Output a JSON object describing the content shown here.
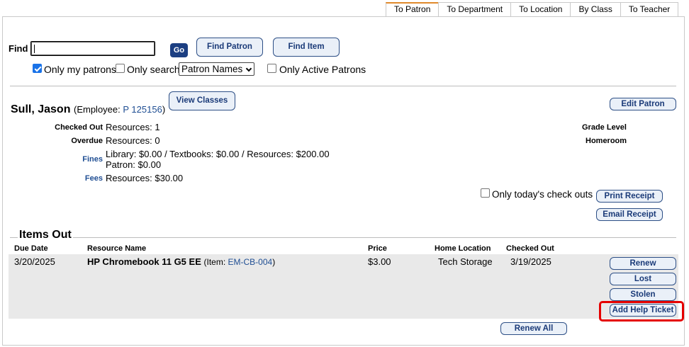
{
  "tabs": [
    {
      "label": "To Patron",
      "active": true
    },
    {
      "label": "To Department",
      "active": false
    },
    {
      "label": "To Location",
      "active": false
    },
    {
      "label": "By Class",
      "active": false
    },
    {
      "label": "To Teacher",
      "active": false
    }
  ],
  "search": {
    "find_label": "Find",
    "find_value": "",
    "go_label": "Go",
    "find_patron_label": "Find Patron",
    "find_item_label": "Find Item",
    "only_my_patrons_label": "Only my patrons",
    "only_my_patrons_checked": true,
    "only_search_label": "Only search",
    "only_search_checked": false,
    "search_scope_selected": "Patron Names",
    "only_active_label": "Only Active Patrons",
    "only_active_checked": false
  },
  "patron": {
    "name": "Sull, Jason",
    "type_prefix": "(Employee: ",
    "id_link": "P 125156",
    "type_suffix": ")",
    "view_classes_label": "View Classes",
    "edit_patron_label": "Edit Patron",
    "checked_out_label": "Checked Out",
    "checked_out_value": "Resources: 1",
    "overdue_label": "Overdue",
    "overdue_value": "Resources: 0",
    "fines_label": "Fines",
    "fines_line1": "Library: $0.00 / Textbooks: $0.00 / Resources: $200.00",
    "fines_line2": "Patron: $0.00",
    "fees_label": "Fees",
    "fees_value": "Resources: $30.00",
    "grade_level_label": "Grade Level",
    "homeroom_label": "Homeroom"
  },
  "receipts": {
    "only_today_label": "Only today's check outs",
    "only_today_checked": false,
    "print_label": "Print Receipt",
    "email_label": "Email Receipt"
  },
  "items_out": {
    "title": "Items Out",
    "columns": {
      "due_date": "Due Date",
      "resource_name": "Resource Name",
      "price": "Price",
      "home_location": "Home Location",
      "checked_out": "Checked Out"
    },
    "rows": [
      {
        "due_date": "3/20/2025",
        "resource_name": "HP Chromebook 11 G5 EE",
        "item_prefix": "(Item: ",
        "item_id": "EM-CB-004",
        "item_suffix": ")",
        "price": "$3.00",
        "home_location": "Tech Storage",
        "checked_out": "3/19/2025"
      }
    ],
    "row_actions": {
      "renew": "Renew",
      "lost": "Lost",
      "stolen": "Stolen",
      "add_help_ticket": "Add Help Ticket"
    },
    "renew_all_label": "Renew All"
  },
  "colors": {
    "accent_tab": "#e08a2c",
    "button_border": "#2d4f86",
    "link": "#1f4e93",
    "highlight": "#e50000"
  }
}
